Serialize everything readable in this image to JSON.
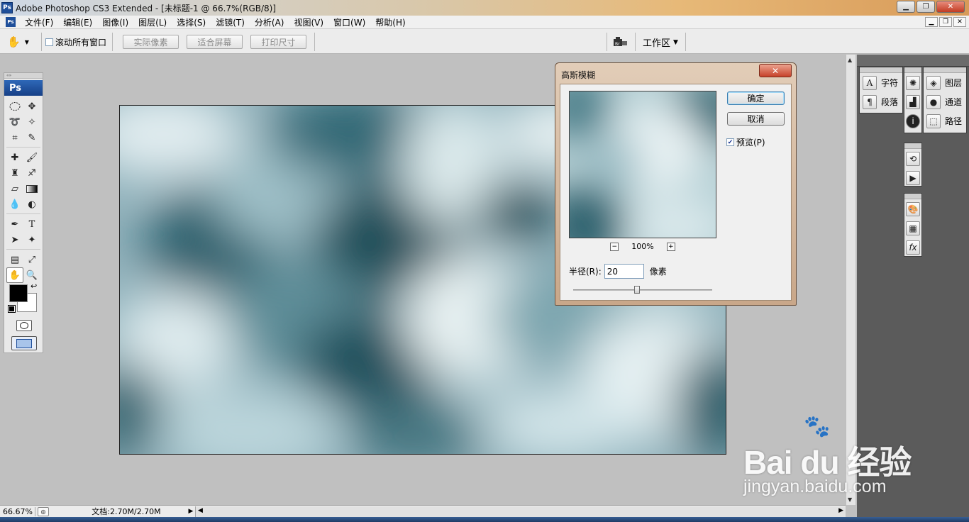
{
  "titlebar": {
    "app_icon": "Ps",
    "title": "Adobe Photoshop CS3 Extended - [未标题-1 @ 66.7%(RGB/8)]"
  },
  "menu": {
    "doc_icon": "Ps",
    "items": [
      "文件(F)",
      "编辑(E)",
      "图像(I)",
      "图层(L)",
      "选择(S)",
      "滤镜(T)",
      "分析(A)",
      "视图(V)",
      "窗口(W)",
      "帮助(H)"
    ]
  },
  "options_bar": {
    "scroll_all_label": "滚动所有窗口",
    "actual_pixels": "实际像素",
    "fit_screen": "适合屏幕",
    "print_size": "打印尺寸",
    "workspace": "工作区"
  },
  "toolbox": {
    "logo": "Ps",
    "foreground_color": "#000000",
    "background_color": "#ffffff"
  },
  "panels": {
    "character": "字符",
    "paragraph": "段落",
    "layers": "图层",
    "channels": "通道",
    "paths": "路径"
  },
  "dialog": {
    "title": "高斯模糊",
    "ok": "确定",
    "cancel": "取消",
    "preview_label": "预览(P)",
    "preview_checked": true,
    "zoom": "100%",
    "radius_label": "半径(R):",
    "radius_value": "20",
    "unit": "像素"
  },
  "status": {
    "zoom": "66.67%",
    "doc_info": "文档:2.70M/2.70M"
  },
  "watermark": {
    "brand": "Bai du 经验",
    "url": "jingyan.baidu.com"
  },
  "colors": {
    "canvas_dark": "#1c4b57",
    "canvas_light": "#e6f1f3",
    "dialog_frame": "#c9a789"
  }
}
